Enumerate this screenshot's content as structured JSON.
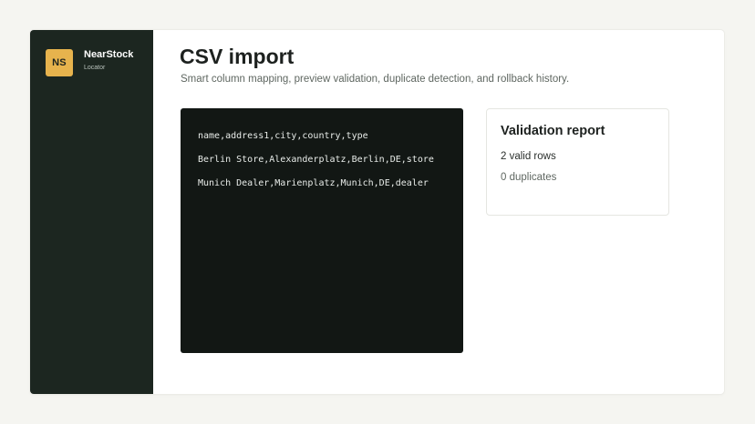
{
  "sidebar": {
    "badge": "NS",
    "brand_name": "NearStock",
    "brand_sub": "Locator"
  },
  "main": {
    "title": "CSV import",
    "subtitle": "Smart column mapping, preview validation, duplicate detection, and rollback history."
  },
  "csv": {
    "lines": [
      "name,address1,city,country,type",
      "Berlin Store,Alexanderplatz,Berlin,DE,store",
      "Munich Dealer,Marienplatz,Munich,DE,dealer"
    ]
  },
  "report": {
    "title": "Validation report",
    "valid_rows": "2 valid rows",
    "duplicates": "0 duplicates"
  },
  "colors": {
    "sidebar_bg": "#1c2620",
    "badge_bg": "#e7b34d",
    "editor_bg": "#121714"
  }
}
